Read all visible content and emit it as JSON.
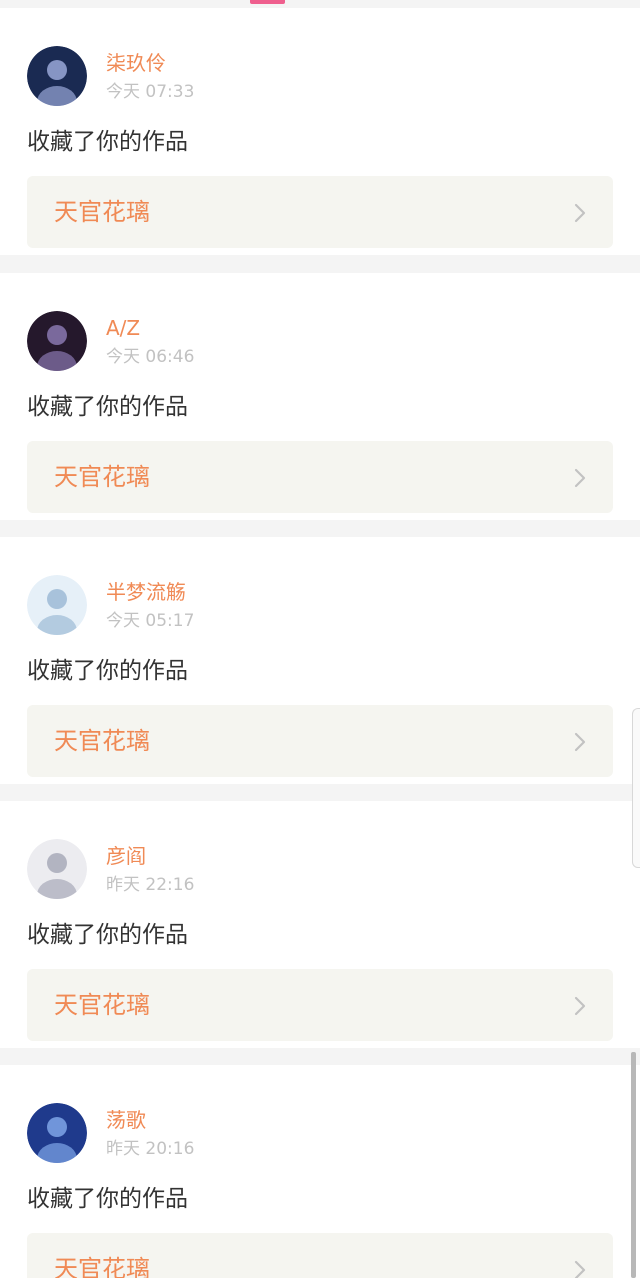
{
  "action_text": "收藏了你的作品",
  "notifications": [
    {
      "username": "柒玖伶",
      "time": "今天 07:33",
      "action": "收藏了你的作品",
      "work_title": "天官花璃",
      "avatar_colors": [
        "#1a2a52",
        "#9aa8d8"
      ]
    },
    {
      "username": "A/Z",
      "time": "今天 06:46",
      "action": "收藏了你的作品",
      "work_title": "天官花璃",
      "avatar_colors": [
        "#25182c",
        "#8a78b0"
      ]
    },
    {
      "username": "半梦流觞",
      "time": "今天 05:17",
      "action": "收藏了你的作品",
      "work_title": "天官花璃",
      "avatar_colors": [
        "#e6f0f8",
        "#9cbad6"
      ]
    },
    {
      "username": "彦阎",
      "time": "昨天 22:16",
      "action": "收藏了你的作品",
      "work_title": "天官花璃",
      "avatar_colors": [
        "#ececf0",
        "#a8aab8"
      ]
    },
    {
      "username": "荡歌",
      "time": "昨天 20:16",
      "action": "收藏了你的作品",
      "work_title": "天官花璃",
      "avatar_colors": [
        "#1f3a8c",
        "#7fa6e8"
      ]
    }
  ],
  "colors": {
    "accent": "#f08a55",
    "tab_indicator": "#ef5f8e",
    "link_background": "#f5f5f0"
  },
  "icons": {
    "chevron": "chevron-right-icon"
  }
}
